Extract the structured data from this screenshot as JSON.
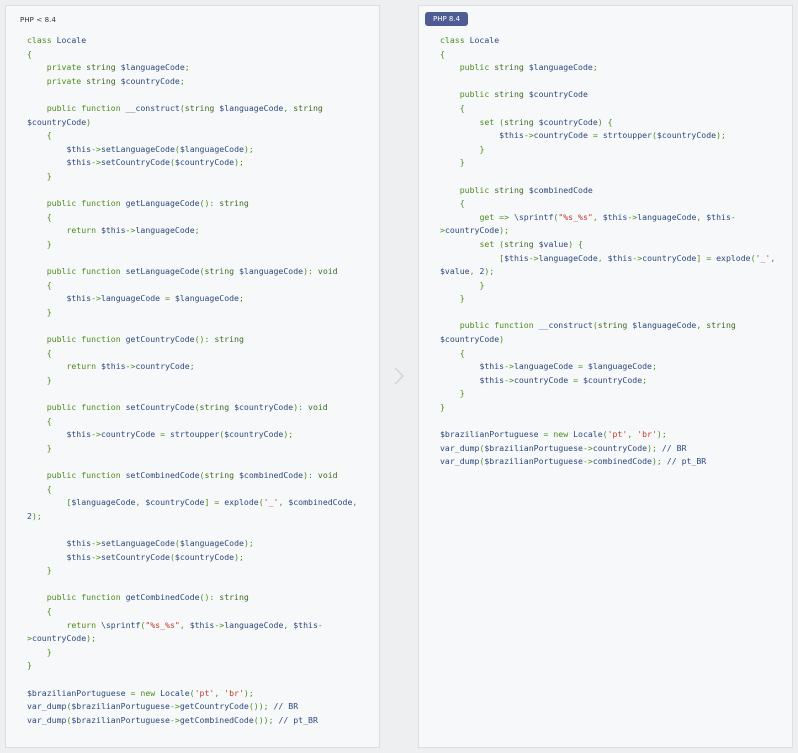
{
  "left_panel": {
    "label": "PHP < 8.4",
    "code_lines": [
      [
        [
          "kw",
          "class "
        ],
        [
          "fn",
          "Locale"
        ]
      ],
      [
        [
          "pun",
          "{"
        ]
      ],
      [
        [
          "kw",
          "    private "
        ],
        [
          "typ",
          "string "
        ],
        [
          "var",
          "$languageCode"
        ],
        [
          "pun",
          ";"
        ]
      ],
      [
        [
          "kw",
          "    private "
        ],
        [
          "typ",
          "string "
        ],
        [
          "var",
          "$countryCode"
        ],
        [
          "pun",
          ";"
        ]
      ],
      [
        [
          "txt",
          ""
        ]
      ],
      [
        [
          "kw",
          "    public function "
        ],
        [
          "fn",
          "__construct"
        ],
        [
          "pun",
          "("
        ],
        [
          "typ",
          "string "
        ],
        [
          "var",
          "$languageCode"
        ],
        [
          "pun",
          ", "
        ],
        [
          "typ",
          "string"
        ]
      ],
      [
        [
          "var",
          "$countryCode"
        ],
        [
          "pun",
          ")"
        ]
      ],
      [
        [
          "pun",
          "    {"
        ]
      ],
      [
        [
          "var",
          "        $this"
        ],
        [
          "pun",
          "->"
        ],
        [
          "fn",
          "setLanguageCode"
        ],
        [
          "pun",
          "("
        ],
        [
          "var",
          "$languageCode"
        ],
        [
          "pun",
          ");"
        ]
      ],
      [
        [
          "var",
          "        $this"
        ],
        [
          "pun",
          "->"
        ],
        [
          "fn",
          "setCountryCode"
        ],
        [
          "pun",
          "("
        ],
        [
          "var",
          "$countryCode"
        ],
        [
          "pun",
          ");"
        ]
      ],
      [
        [
          "pun",
          "    }"
        ]
      ],
      [
        [
          "txt",
          ""
        ]
      ],
      [
        [
          "kw",
          "    public function "
        ],
        [
          "fn",
          "getLanguageCode"
        ],
        [
          "pun",
          "(): "
        ],
        [
          "typ",
          "string"
        ]
      ],
      [
        [
          "pun",
          "    {"
        ]
      ],
      [
        [
          "kw",
          "        return "
        ],
        [
          "var",
          "$this"
        ],
        [
          "pun",
          "->"
        ],
        [
          "txt",
          "languageCode"
        ],
        [
          "pun",
          ";"
        ]
      ],
      [
        [
          "pun",
          "    }"
        ]
      ],
      [
        [
          "txt",
          ""
        ]
      ],
      [
        [
          "kw",
          "    public function "
        ],
        [
          "fn",
          "setLanguageCode"
        ],
        [
          "pun",
          "("
        ],
        [
          "typ",
          "string "
        ],
        [
          "var",
          "$languageCode"
        ],
        [
          "pun",
          "): "
        ],
        [
          "typ",
          "void"
        ]
      ],
      [
        [
          "pun",
          "    {"
        ]
      ],
      [
        [
          "var",
          "        $this"
        ],
        [
          "pun",
          "->"
        ],
        [
          "txt",
          "languageCode "
        ],
        [
          "pun",
          "= "
        ],
        [
          "var",
          "$languageCode"
        ],
        [
          "pun",
          ";"
        ]
      ],
      [
        [
          "pun",
          "    }"
        ]
      ],
      [
        [
          "txt",
          ""
        ]
      ],
      [
        [
          "kw",
          "    public function "
        ],
        [
          "fn",
          "getCountryCode"
        ],
        [
          "pun",
          "(): "
        ],
        [
          "typ",
          "string"
        ]
      ],
      [
        [
          "pun",
          "    {"
        ]
      ],
      [
        [
          "kw",
          "        return "
        ],
        [
          "var",
          "$this"
        ],
        [
          "pun",
          "->"
        ],
        [
          "txt",
          "countryCode"
        ],
        [
          "pun",
          ";"
        ]
      ],
      [
        [
          "pun",
          "    }"
        ]
      ],
      [
        [
          "txt",
          ""
        ]
      ],
      [
        [
          "kw",
          "    public function "
        ],
        [
          "fn",
          "setCountryCode"
        ],
        [
          "pun",
          "("
        ],
        [
          "typ",
          "string "
        ],
        [
          "var",
          "$countryCode"
        ],
        [
          "pun",
          "): "
        ],
        [
          "typ",
          "void"
        ]
      ],
      [
        [
          "pun",
          "    {"
        ]
      ],
      [
        [
          "var",
          "        $this"
        ],
        [
          "pun",
          "->"
        ],
        [
          "txt",
          "countryCode "
        ],
        [
          "pun",
          "= "
        ],
        [
          "fn",
          "strtoupper"
        ],
        [
          "pun",
          "("
        ],
        [
          "var",
          "$countryCode"
        ],
        [
          "pun",
          ");"
        ]
      ],
      [
        [
          "pun",
          "    }"
        ]
      ],
      [
        [
          "txt",
          ""
        ]
      ],
      [
        [
          "kw",
          "    public function "
        ],
        [
          "fn",
          "setCombinedCode"
        ],
        [
          "pun",
          "("
        ],
        [
          "typ",
          "string "
        ],
        [
          "var",
          "$combinedCode"
        ],
        [
          "pun",
          "): "
        ],
        [
          "typ",
          "void"
        ]
      ],
      [
        [
          "pun",
          "    {"
        ]
      ],
      [
        [
          "pun",
          "        ["
        ],
        [
          "var",
          "$languageCode"
        ],
        [
          "pun",
          ", "
        ],
        [
          "var",
          "$countryCode"
        ],
        [
          "pun",
          "] = "
        ],
        [
          "fn",
          "explode"
        ],
        [
          "pun",
          "("
        ],
        [
          "str",
          "'_'"
        ],
        [
          "pun",
          ", "
        ],
        [
          "var",
          "$combinedCode"
        ],
        [
          "pun",
          ","
        ]
      ],
      [
        [
          "txt",
          "2"
        ],
        [
          "pun",
          ");"
        ]
      ],
      [
        [
          "txt",
          ""
        ]
      ],
      [
        [
          "var",
          "        $this"
        ],
        [
          "pun",
          "->"
        ],
        [
          "fn",
          "setLanguageCode"
        ],
        [
          "pun",
          "("
        ],
        [
          "var",
          "$languageCode"
        ],
        [
          "pun",
          ");"
        ]
      ],
      [
        [
          "var",
          "        $this"
        ],
        [
          "pun",
          "->"
        ],
        [
          "fn",
          "setCountryCode"
        ],
        [
          "pun",
          "("
        ],
        [
          "var",
          "$countryCode"
        ],
        [
          "pun",
          ");"
        ]
      ],
      [
        [
          "pun",
          "    }"
        ]
      ],
      [
        [
          "txt",
          ""
        ]
      ],
      [
        [
          "kw",
          "    public function "
        ],
        [
          "fn",
          "getCombinedCode"
        ],
        [
          "pun",
          "(): "
        ],
        [
          "typ",
          "string"
        ]
      ],
      [
        [
          "pun",
          "    {"
        ]
      ],
      [
        [
          "kw",
          "        return "
        ],
        [
          "fn",
          "\\sprintf"
        ],
        [
          "pun",
          "("
        ],
        [
          "str",
          "\"%s_%s\""
        ],
        [
          "pun",
          ", "
        ],
        [
          "var",
          "$this"
        ],
        [
          "pun",
          "->"
        ],
        [
          "txt",
          "languageCode"
        ],
        [
          "pun",
          ", "
        ],
        [
          "var",
          "$this"
        ],
        [
          "pun",
          "-"
        ]
      ],
      [
        [
          "pun",
          ">"
        ],
        [
          "txt",
          "countryCode"
        ],
        [
          "pun",
          ");"
        ]
      ],
      [
        [
          "pun",
          "    }"
        ]
      ],
      [
        [
          "pun",
          "}"
        ]
      ],
      [
        [
          "txt",
          ""
        ]
      ],
      [
        [
          "var",
          "$brazilianPortuguese "
        ],
        [
          "pun",
          "= "
        ],
        [
          "kw",
          "new "
        ],
        [
          "fn",
          "Locale"
        ],
        [
          "pun",
          "("
        ],
        [
          "str",
          "'pt'"
        ],
        [
          "pun",
          ", "
        ],
        [
          "str",
          "'br'"
        ],
        [
          "pun",
          ");"
        ]
      ],
      [
        [
          "fn",
          "var_dump"
        ],
        [
          "pun",
          "("
        ],
        [
          "var",
          "$brazilianPortuguese"
        ],
        [
          "pun",
          "->"
        ],
        [
          "fn",
          "getCountryCode"
        ],
        [
          "pun",
          "()); "
        ],
        [
          "txt",
          "// BR"
        ]
      ],
      [
        [
          "fn",
          "var_dump"
        ],
        [
          "pun",
          "("
        ],
        [
          "var",
          "$brazilianPortuguese"
        ],
        [
          "pun",
          "->"
        ],
        [
          "fn",
          "getCombinedCode"
        ],
        [
          "pun",
          "()); "
        ],
        [
          "txt",
          "// pt_BR"
        ]
      ]
    ]
  },
  "right_panel": {
    "label": "PHP 8.4",
    "code_lines": [
      [
        [
          "kw",
          "class "
        ],
        [
          "fn",
          "Locale"
        ]
      ],
      [
        [
          "pun",
          "{"
        ]
      ],
      [
        [
          "kw",
          "    public "
        ],
        [
          "typ",
          "string "
        ],
        [
          "var",
          "$languageCode"
        ],
        [
          "pun",
          ";"
        ]
      ],
      [
        [
          "txt",
          ""
        ]
      ],
      [
        [
          "kw",
          "    public "
        ],
        [
          "typ",
          "string "
        ],
        [
          "var",
          "$countryCode"
        ]
      ],
      [
        [
          "pun",
          "    {"
        ]
      ],
      [
        [
          "kw",
          "        set "
        ],
        [
          "pun",
          "("
        ],
        [
          "typ",
          "string "
        ],
        [
          "var",
          "$countryCode"
        ],
        [
          "pun",
          ") {"
        ]
      ],
      [
        [
          "var",
          "            $this"
        ],
        [
          "pun",
          "->"
        ],
        [
          "txt",
          "countryCode "
        ],
        [
          "pun",
          "= "
        ],
        [
          "fn",
          "strtoupper"
        ],
        [
          "pun",
          "("
        ],
        [
          "var",
          "$countryCode"
        ],
        [
          "pun",
          ");"
        ]
      ],
      [
        [
          "pun",
          "        }"
        ]
      ],
      [
        [
          "pun",
          "    }"
        ]
      ],
      [
        [
          "txt",
          ""
        ]
      ],
      [
        [
          "kw",
          "    public "
        ],
        [
          "typ",
          "string "
        ],
        [
          "var",
          "$combinedCode"
        ]
      ],
      [
        [
          "pun",
          "    {"
        ]
      ],
      [
        [
          "kw",
          "        get "
        ],
        [
          "pun",
          "=> "
        ],
        [
          "fn",
          "\\sprintf"
        ],
        [
          "pun",
          "("
        ],
        [
          "str",
          "\"%s_%s\""
        ],
        [
          "pun",
          ", "
        ],
        [
          "var",
          "$this"
        ],
        [
          "pun",
          "->"
        ],
        [
          "txt",
          "languageCode"
        ],
        [
          "pun",
          ", "
        ],
        [
          "var",
          "$this"
        ],
        [
          "pun",
          "-"
        ]
      ],
      [
        [
          "pun",
          ">"
        ],
        [
          "txt",
          "countryCode"
        ],
        [
          "pun",
          ");"
        ]
      ],
      [
        [
          "kw",
          "        set "
        ],
        [
          "pun",
          "("
        ],
        [
          "typ",
          "string "
        ],
        [
          "var",
          "$value"
        ],
        [
          "pun",
          ") {"
        ]
      ],
      [
        [
          "pun",
          "            ["
        ],
        [
          "var",
          "$this"
        ],
        [
          "pun",
          "->"
        ],
        [
          "txt",
          "languageCode"
        ],
        [
          "pun",
          ", "
        ],
        [
          "var",
          "$this"
        ],
        [
          "pun",
          "->"
        ],
        [
          "txt",
          "countryCode"
        ],
        [
          "pun",
          "] = "
        ],
        [
          "fn",
          "explode"
        ],
        [
          "pun",
          "("
        ],
        [
          "str",
          "'_'"
        ],
        [
          "pun",
          ","
        ]
      ],
      [
        [
          "var",
          "$value"
        ],
        [
          "pun",
          ", "
        ],
        [
          "txt",
          "2"
        ],
        [
          "pun",
          ");"
        ]
      ],
      [
        [
          "pun",
          "        }"
        ]
      ],
      [
        [
          "pun",
          "    }"
        ]
      ],
      [
        [
          "txt",
          ""
        ]
      ],
      [
        [
          "kw",
          "    public function "
        ],
        [
          "fn",
          "__construct"
        ],
        [
          "pun",
          "("
        ],
        [
          "typ",
          "string "
        ],
        [
          "var",
          "$languageCode"
        ],
        [
          "pun",
          ", "
        ],
        [
          "typ",
          "string"
        ]
      ],
      [
        [
          "var",
          "$countryCode"
        ],
        [
          "pun",
          ")"
        ]
      ],
      [
        [
          "pun",
          "    {"
        ]
      ],
      [
        [
          "var",
          "        $this"
        ],
        [
          "pun",
          "->"
        ],
        [
          "txt",
          "languageCode "
        ],
        [
          "pun",
          "= "
        ],
        [
          "var",
          "$languageCode"
        ],
        [
          "pun",
          ";"
        ]
      ],
      [
        [
          "var",
          "        $this"
        ],
        [
          "pun",
          "->"
        ],
        [
          "txt",
          "countryCode "
        ],
        [
          "pun",
          "= "
        ],
        [
          "var",
          "$countryCode"
        ],
        [
          "pun",
          ";"
        ]
      ],
      [
        [
          "pun",
          "    }"
        ]
      ],
      [
        [
          "pun",
          "}"
        ]
      ],
      [
        [
          "txt",
          ""
        ]
      ],
      [
        [
          "var",
          "$brazilianPortuguese "
        ],
        [
          "pun",
          "= "
        ],
        [
          "kw",
          "new "
        ],
        [
          "fn",
          "Locale"
        ],
        [
          "pun",
          "("
        ],
        [
          "str",
          "'pt'"
        ],
        [
          "pun",
          ", "
        ],
        [
          "str",
          "'br'"
        ],
        [
          "pun",
          ");"
        ]
      ],
      [
        [
          "fn",
          "var_dump"
        ],
        [
          "pun",
          "("
        ],
        [
          "var",
          "$brazilianPortuguese"
        ],
        [
          "pun",
          "->"
        ],
        [
          "txt",
          "countryCode"
        ],
        [
          "pun",
          "); "
        ],
        [
          "txt",
          "// BR"
        ]
      ],
      [
        [
          "fn",
          "var_dump"
        ],
        [
          "pun",
          "("
        ],
        [
          "var",
          "$brazilianPortuguese"
        ],
        [
          "pun",
          "->"
        ],
        [
          "txt",
          "combinedCode"
        ],
        [
          "pun",
          "); "
        ],
        [
          "txt",
          "// pt_BR"
        ]
      ]
    ]
  },
  "divider": {
    "icon": "chevron-right-icon"
  },
  "colors": {
    "badge_bg": "#4f5b93",
    "keyword": "#4d8b1b",
    "variable": "#2d4a7a",
    "string": "#c0392b",
    "panel_bg": "#f7f8fa",
    "page_bg": "#eeeff1"
  }
}
